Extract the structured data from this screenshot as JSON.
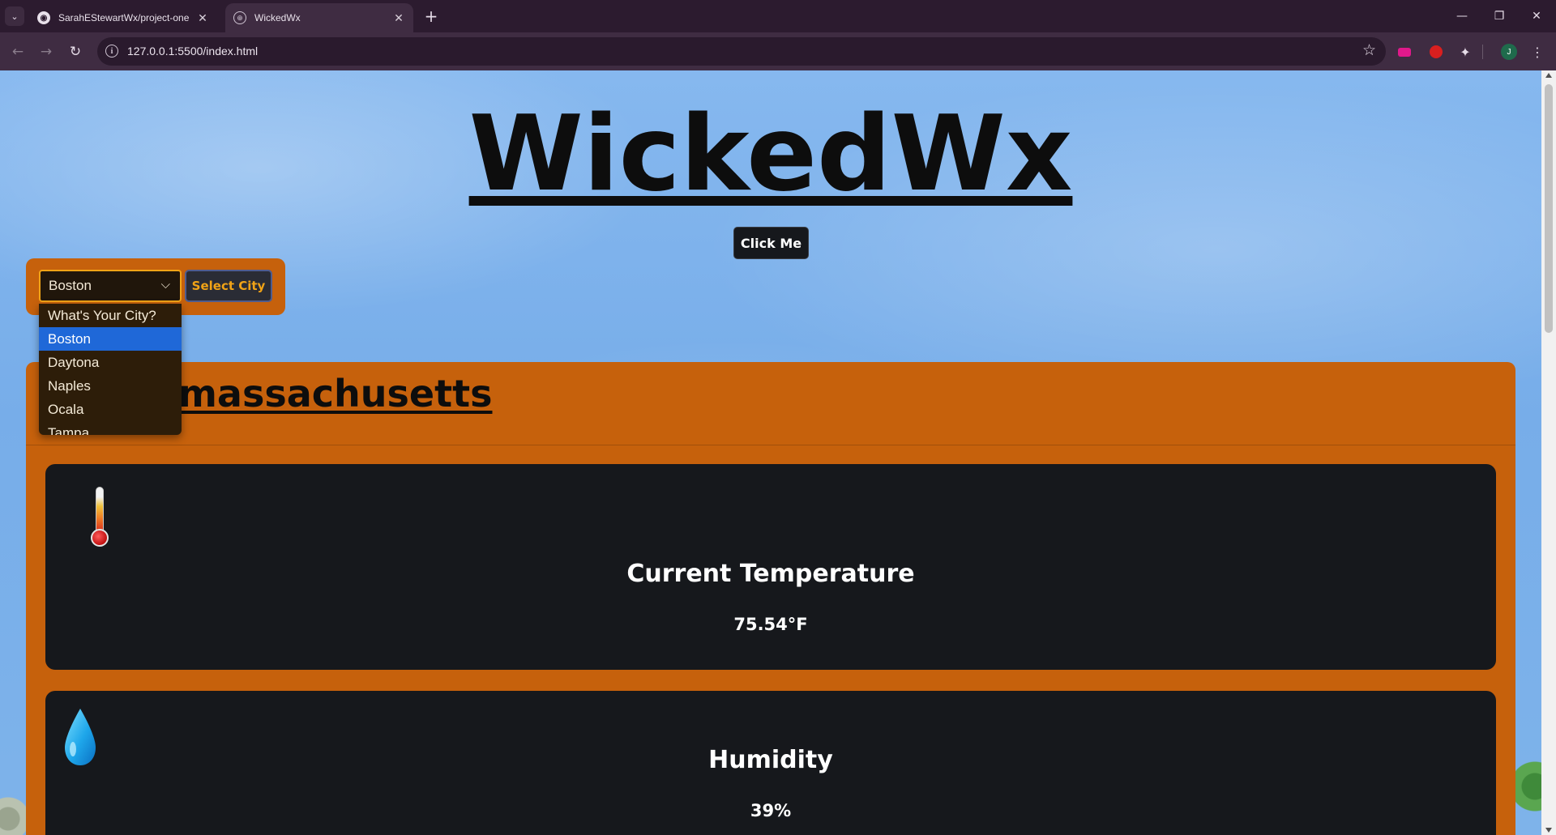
{
  "browser": {
    "tabs": [
      {
        "title": "SarahEStewartWx/project-one",
        "icon": "github-icon",
        "active": false
      },
      {
        "title": "WickedWx",
        "icon": "globe-icon",
        "active": true
      }
    ],
    "url": "127.0.0.1:5500/index.html",
    "profile_initial": "J"
  },
  "page": {
    "title": "WickedWx",
    "click_button": "Click Me",
    "city_select": {
      "selected": "Boston",
      "button": "Select City",
      "options": [
        "What's Your City?",
        "Boston",
        "Daytona",
        "Naples",
        "Ocala",
        "Tampa"
      ],
      "highlighted_index": 1
    },
    "location_heading": "massachusetts",
    "cards": {
      "temperature": {
        "title": "Current Temperature",
        "value": "75.54°F",
        "icon": "thermometer-icon"
      },
      "humidity": {
        "title": "Humidity",
        "value": "39%",
        "icon": "water-drop-icon"
      }
    }
  },
  "colors": {
    "panel": "#c6610c",
    "card": "#16181c",
    "accent": "#f1a316",
    "sky": "#7eb3ea"
  }
}
